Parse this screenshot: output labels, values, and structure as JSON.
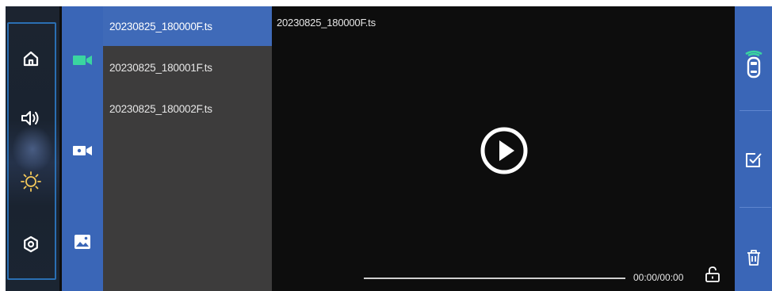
{
  "sidebar": {
    "items": [
      {
        "icon": "home-icon"
      },
      {
        "icon": "volume-icon"
      },
      {
        "icon": "brightness-icon"
      },
      {
        "icon": "settings-icon"
      }
    ]
  },
  "categories": {
    "items": [
      {
        "icon": "video-camera-icon",
        "active": true
      },
      {
        "icon": "camera-icon",
        "active": false
      },
      {
        "icon": "image-icon",
        "active": false
      }
    ]
  },
  "files": [
    {
      "name": "20230825_180000F.ts",
      "selected": true
    },
    {
      "name": "20230825_180001F.ts",
      "selected": false
    },
    {
      "name": "20230825_180002F.ts",
      "selected": false
    }
  ],
  "player": {
    "title": "20230825_180000F.ts",
    "time": "00:00/00:00",
    "progress": 0
  },
  "actions": {
    "items": [
      {
        "icon": "car-camera-icon"
      },
      {
        "icon": "select-check-icon"
      },
      {
        "icon": "trash-icon"
      }
    ]
  },
  "colors": {
    "accent_blue": "#3a66b7",
    "active_green": "#3ad5a0",
    "highlight": "#3f6ab8"
  }
}
